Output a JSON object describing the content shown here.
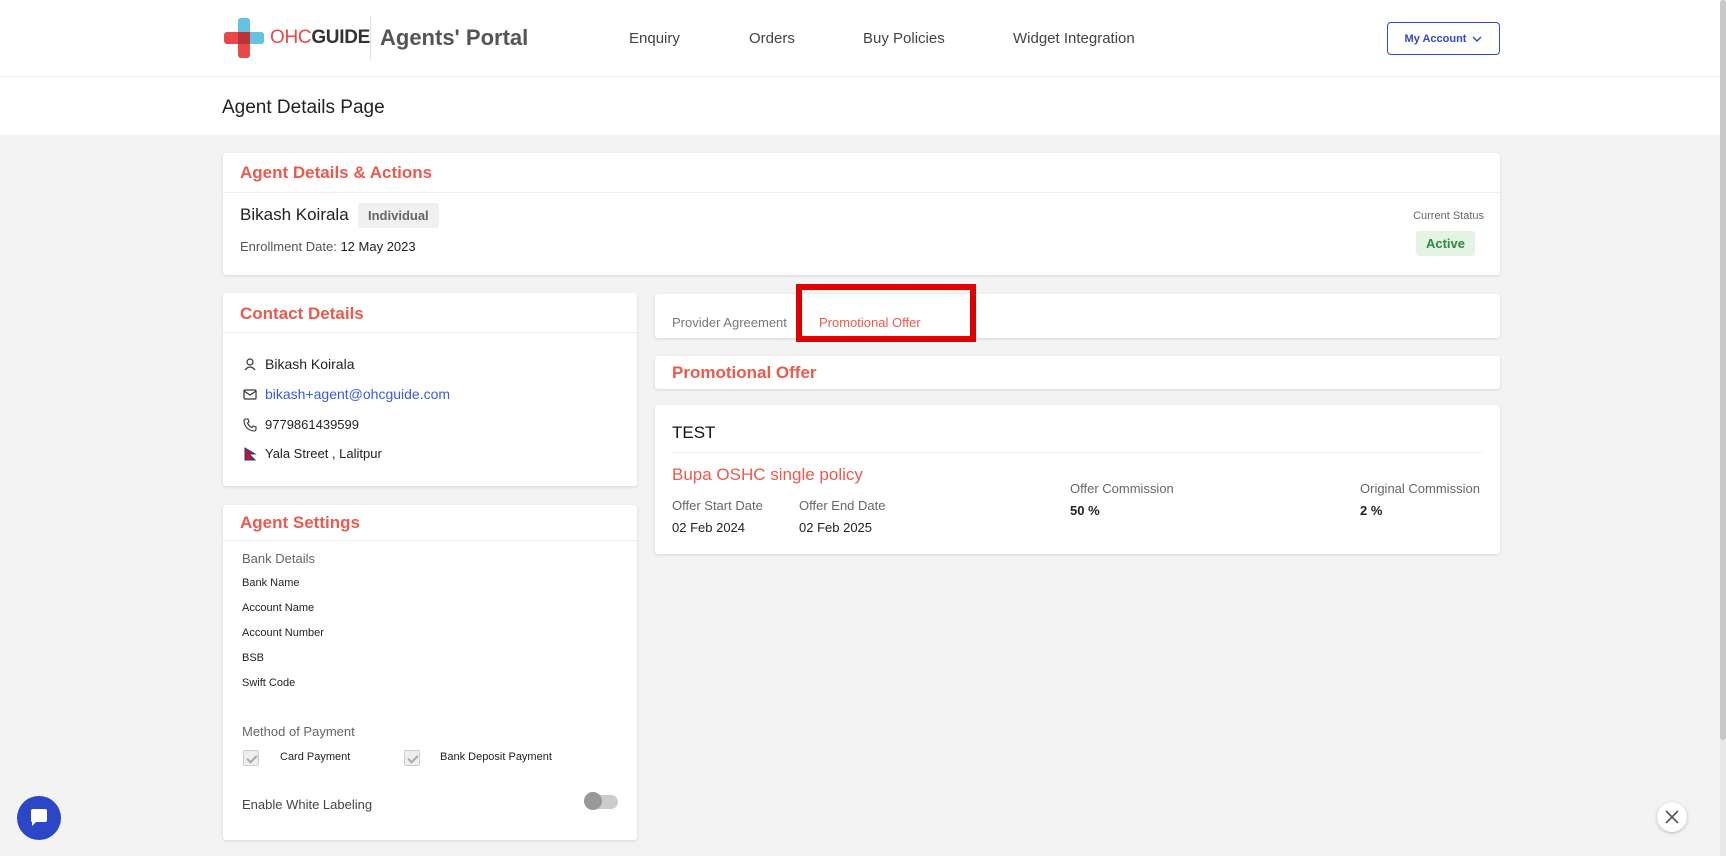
{
  "header": {
    "brand_part1": "OHC",
    "brand_part2": "GUIDE",
    "portal_title": "Agents' Portal",
    "nav": [
      "Enquiry",
      "Orders",
      "Buy Policies",
      "Widget Integration"
    ],
    "account_label": "My Account"
  },
  "page_title": "Agent Details Page",
  "agent_card": {
    "title": "Agent Details & Actions",
    "name": "Bikash Koirala",
    "type_badge": "Individual",
    "enrollment_label": "Enrollment Date:",
    "enrollment_date": "12 May 2023",
    "status_label": "Current Status",
    "status_value": "Active"
  },
  "contact": {
    "title": "Contact Details",
    "name": "Bikash Koirala",
    "email": "bikash+agent@ohcguide.com",
    "phone": "9779861439599",
    "address": "Yala Street , Lalitpur"
  },
  "settings": {
    "title": "Agent Settings",
    "bank_details_label": "Bank Details",
    "bank_fields": [
      "Bank Name",
      "Account Name",
      "Account Number",
      "BSB",
      "Swift Code"
    ],
    "payment_label": "Method of Payment",
    "payment_options": [
      "Card Payment",
      "Bank Deposit Payment"
    ],
    "white_label": "Enable White Labeling"
  },
  "tabs": [
    "Provider Agreement",
    "Promotional Offer"
  ],
  "promo": {
    "section_title": "Promotional Offer",
    "offer_name": "TEST",
    "policy": "Bupa OSHC single policy",
    "start_label": "Offer Start Date",
    "start_date": "02 Feb 2024",
    "end_label": "Offer End Date",
    "end_date": "02 Feb 2025",
    "offer_commission_label": "Offer Commission",
    "offer_commission": "50 %",
    "original_commission_label": "Original Commission",
    "original_commission": "2 %"
  },
  "colors": {
    "accent": "#ea5a4f",
    "primary": "#2f49c4",
    "status_green": "#2e8b3a",
    "highlight_box": "#e00000"
  }
}
